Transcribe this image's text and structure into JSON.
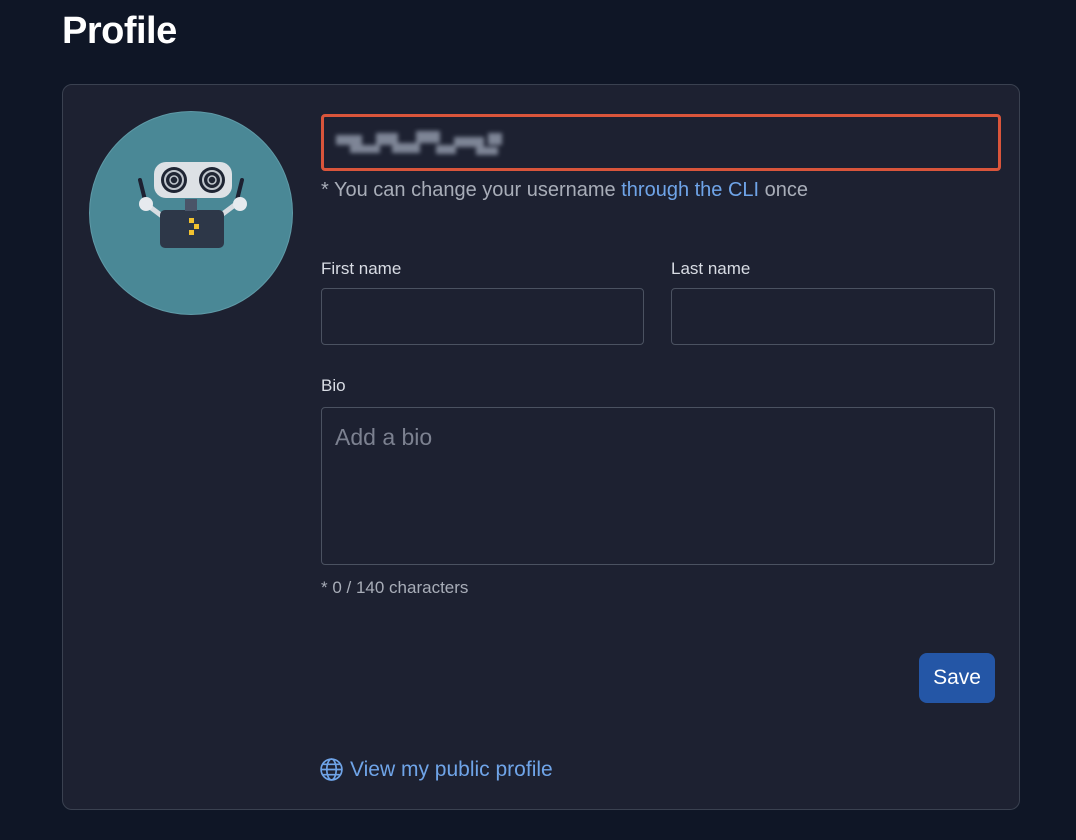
{
  "page": {
    "title": "Profile"
  },
  "profile": {
    "username_hint_prefix": "* You can change your username",
    "username_hint_link": "through the CLI",
    "username_hint_suffix": "once",
    "first_name_label": "First name",
    "first_name_value": "",
    "last_name_label": "Last name",
    "last_name_value": "",
    "bio_label": "Bio",
    "bio_placeholder": "Add a bio",
    "bio_value": "",
    "char_count": "* 0 / 140 characters",
    "save_label": "Save",
    "public_profile_link": "View my public profile"
  },
  "icons": {
    "avatar": "robot-avatar",
    "public_profile": "globe-icon"
  },
  "colors": {
    "background": "#0f1626",
    "card": "#1d2131",
    "accent_link": "#6fa4e8",
    "save_button": "#2456a6",
    "focus_border": "#d9553b"
  }
}
